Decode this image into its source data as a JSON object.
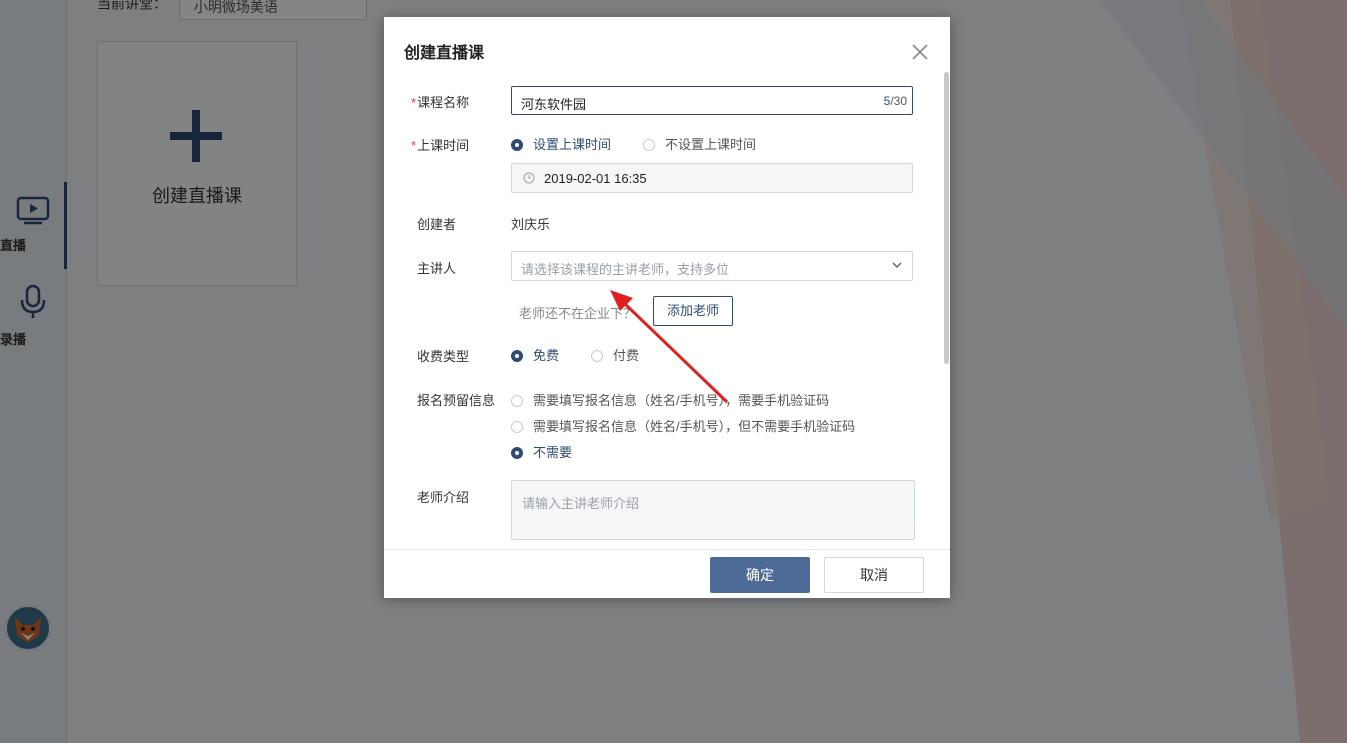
{
  "background": {
    "topbar": {
      "label": "当前讲堂：",
      "selected": "小明微场美语"
    },
    "sidebar": {
      "items": [
        {
          "label": "直播",
          "icon": "tv-play-icon"
        },
        {
          "label": "录播",
          "icon": "microphone-icon"
        }
      ]
    },
    "create_card": {
      "label": "创建直播课"
    }
  },
  "dialog": {
    "title": "创建直播课",
    "course_name": {
      "label": "课程名称",
      "required_mark": "*",
      "value": "河东软件园",
      "count": "5",
      "max": "/30"
    },
    "class_time": {
      "label": "上课时间",
      "required_mark": "*",
      "options": [
        "设置上课时间",
        "不设置上课时间"
      ],
      "selected_index": 0,
      "datetime": "2019-02-01 16:35"
    },
    "creator": {
      "label": "创建者",
      "value": "刘庆乐"
    },
    "lecturer": {
      "label": "主讲人",
      "placeholder": "请选择该课程的主讲老师，支持多位",
      "hint": "老师还不在企业下？",
      "add_button": "添加老师"
    },
    "fee_type": {
      "label": "收费类型",
      "options": [
        "免费",
        "付费"
      ],
      "selected_index": 0
    },
    "registration": {
      "label": "报名预留信息",
      "options": [
        "需要填写报名信息（姓名/手机号），需要手机验证码",
        "需要填写报名信息（姓名/手机号），但不需要手机验证码",
        "不需要"
      ],
      "selected_index": 2
    },
    "teacher_intro": {
      "label": "老师介绍",
      "placeholder": "请输入主讲老师介绍"
    },
    "buttons": {
      "ok": "确定",
      "cancel": "取消"
    }
  },
  "colors": {
    "accent": "#2f4a75",
    "primary_button": "#4e6b98",
    "required": "#e23d3d",
    "annotation_arrow": "#e02020"
  }
}
